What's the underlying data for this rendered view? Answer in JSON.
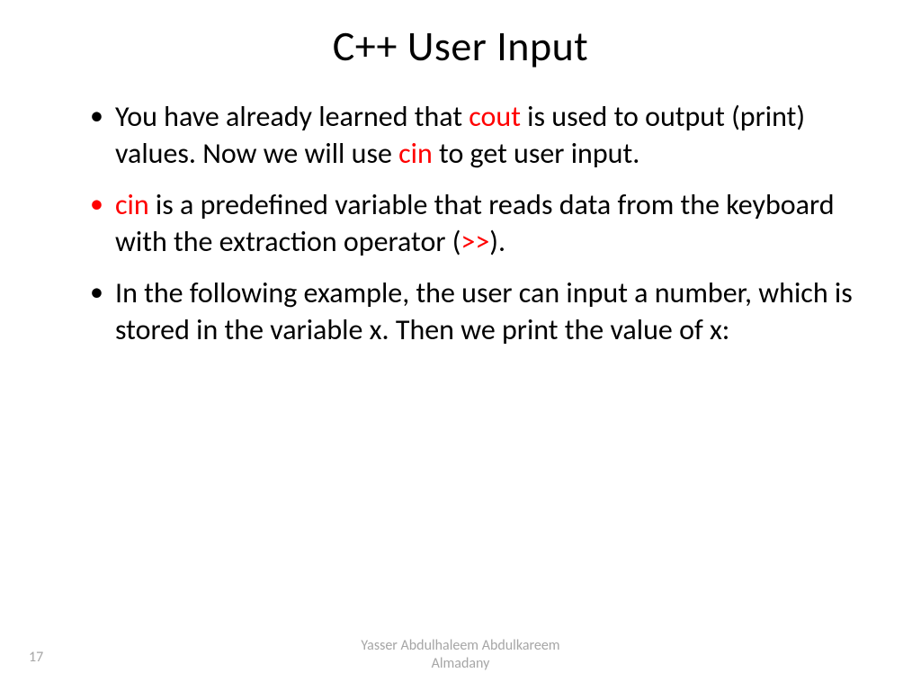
{
  "title": "C++ User Input",
  "bullets": {
    "b1": {
      "p1": "You have already learned that ",
      "k1": "cout",
      "p2": " is used to output (print) values. Now we will use ",
      "k2": "cin",
      "p3": " to get user input."
    },
    "b2": {
      "k1": "cin",
      "p1": " is a predefined variable that reads data from the keyboard with the extraction operator (",
      "k2": ">>",
      "p2": ")."
    },
    "b3": {
      "p1": "In the following example, the user can input a number, which is stored in the variable x. Then we print the value of x:"
    }
  },
  "footer": {
    "page": "17",
    "author_line1": "Yasser Abdulhaleem Abdulkareem",
    "author_line2": "Almadany"
  }
}
